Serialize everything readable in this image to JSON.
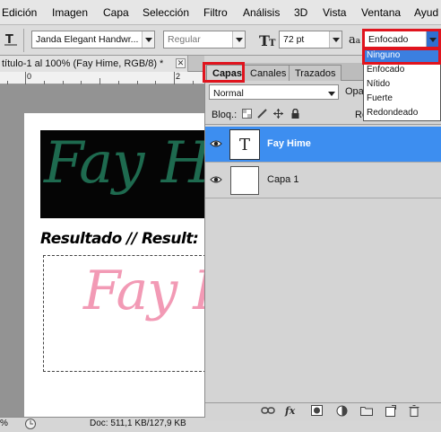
{
  "menubar": {
    "items": [
      "Edición",
      "Imagen",
      "Capa",
      "Selección",
      "Filtro",
      "Análisis",
      "3D",
      "Vista",
      "Ventana",
      "Ayud"
    ]
  },
  "options": {
    "tool_icon": "vertical-type-icon",
    "font_family": "Janda Elegant Handwr...",
    "font_style": "Regular",
    "font_size": "72 pt",
    "aa_label": "a",
    "aa_label_sub": "a",
    "antialias": "Enfocado"
  },
  "antialias_menu": {
    "options": [
      "Ninguno",
      "Enfocado",
      "Nítido",
      "Fuerte",
      "Redondeado"
    ],
    "selected_index": 0
  },
  "document": {
    "tab_title": "título-1 al 100% (Fay Hime, RGB/8) *",
    "close_glyph": "✕",
    "ruler_labels": [
      "0",
      "2"
    ],
    "banner_text": "Fay Hi",
    "result_label": "Resultado // Result:",
    "result_text": "Fay Hime"
  },
  "layers_panel": {
    "tabs": [
      "Capas",
      "Canales",
      "Trazados"
    ],
    "blend_mode": "Normal",
    "opacity_label": "Opac",
    "lock_label": "Bloq.:",
    "fill_label": "Re",
    "layers": [
      {
        "name": "Fay Hime",
        "thumb": "T",
        "selected": true
      },
      {
        "name": "Capa 1",
        "thumb": "",
        "selected": false
      }
    ],
    "bottom_icons": [
      "link-icon",
      "fx-icon",
      "mask-icon",
      "adjustment-icon",
      "group-icon",
      "new-layer-icon",
      "trash-icon"
    ],
    "fx_label": "fx"
  },
  "status": {
    "zoom": "%",
    "doc_size": "Doc: 511,1 KB/127,9 KB"
  },
  "colors": {
    "accent_selected": "#3d8ef0",
    "highlight_red": "#e0141e",
    "banner_text": "#1e6a4f",
    "result_text": "#f29ab5"
  }
}
